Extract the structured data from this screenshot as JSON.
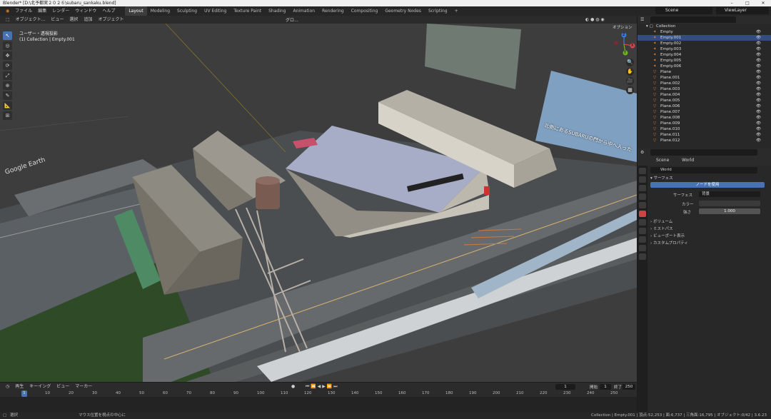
{
  "window": {
    "title": "Blender* [D:\\北予都実２０２６\\subaru_sankaku.blend]",
    "controls": [
      "–",
      "□",
      "✕"
    ]
  },
  "menus": [
    "ファイル",
    "編集",
    "レンダー",
    "ウィンドウ",
    "ヘルプ"
  ],
  "workspaces": [
    "Layout",
    "Modeling",
    "Sculpting",
    "UV Editing",
    "Texture Paint",
    "Shading",
    "Animation",
    "Rendering",
    "Compositing",
    "Geometry Nodes",
    "Scripting",
    "+"
  ],
  "active_workspace": "Layout",
  "scene_field": "Scene",
  "viewlayer_field": "ViewLayer",
  "viewport_header": {
    "mode": "オブジェクト...",
    "menus": [
      "ビュー",
      "選択",
      "追加",
      "オブジェクト"
    ],
    "transform": "グロ...",
    "options": "オプション"
  },
  "viewport_overlay": {
    "line1": "ユーザー・透視投影",
    "line2": "(1) Collection | Empty.001"
  },
  "tools": [
    "↖",
    "◎",
    "✥",
    "⟳",
    "⤢",
    "⊕",
    "✎",
    "📐",
    "⊞"
  ],
  "gizmo": {
    "x": "X",
    "y": "Y",
    "z": "Z"
  },
  "billboard_text": "北側にあるSUBARUの門から中へ入った",
  "map_label": "Google Earth",
  "outliner": {
    "root": "Collection",
    "items": [
      {
        "name": "Empty",
        "kind": "empty"
      },
      {
        "name": "Empty.001",
        "kind": "empty",
        "selected": true
      },
      {
        "name": "Empty.002",
        "kind": "empty"
      },
      {
        "name": "Empty.003",
        "kind": "empty"
      },
      {
        "name": "Empty.004",
        "kind": "empty"
      },
      {
        "name": "Empty.005",
        "kind": "empty"
      },
      {
        "name": "Empty.006",
        "kind": "empty"
      },
      {
        "name": "Plane",
        "kind": "mesh"
      },
      {
        "name": "Plane.001",
        "kind": "mesh"
      },
      {
        "name": "Plane.002",
        "kind": "mesh"
      },
      {
        "name": "Plane.003",
        "kind": "mesh"
      },
      {
        "name": "Plane.004",
        "kind": "mesh"
      },
      {
        "name": "Plane.005",
        "kind": "mesh"
      },
      {
        "name": "Plane.006",
        "kind": "mesh"
      },
      {
        "name": "Plane.007",
        "kind": "mesh"
      },
      {
        "name": "Plane.008",
        "kind": "mesh"
      },
      {
        "name": "Plane.009",
        "kind": "mesh"
      },
      {
        "name": "Plane.010",
        "kind": "mesh"
      },
      {
        "name": "Plane.011",
        "kind": "mesh"
      },
      {
        "name": "Plane.012",
        "kind": "mesh"
      }
    ]
  },
  "properties": {
    "breadcrumb_scene": "Scene",
    "breadcrumb_world": "World",
    "world_name": "World",
    "section_surface": "サーフェス",
    "use_nodes": "ノードを使用",
    "surface_label": "サーフェス",
    "surface_value": "背景",
    "color_label": "カラー",
    "strength_label": "強さ",
    "strength_value": "1.000",
    "panels": [
      "ボリューム",
      "ミストパス",
      "ビューポート表示",
      "カスタムプロパティ"
    ]
  },
  "timeline": {
    "menus": [
      "再生",
      "キーイング",
      "ビュー",
      "マーカー"
    ],
    "current": "1",
    "start_label": "開始",
    "start": "1",
    "end_label": "終了",
    "end": "250",
    "ticks": [
      "1",
      "10",
      "20",
      "30",
      "40",
      "50",
      "60",
      "70",
      "80",
      "90",
      "100",
      "110",
      "120",
      "130",
      "140",
      "150",
      "160",
      "170",
      "180",
      "190",
      "200",
      "210",
      "220",
      "230",
      "240",
      "250"
    ]
  },
  "status_bar": {
    "left": "選択",
    "center": "マウス位置を視点の中心に",
    "right": "Collection | Empty.001 | 頂点:52,253 | 面:6,737 | 三角面:16,795 | オブジェクト:0/42 | 3.6.23"
  },
  "colors": {
    "accent": "#4772b3",
    "selection": "#334d80",
    "empty_icon": "#e0823a",
    "mesh_icon": "#e07a2a",
    "warehouse_roof": "#9ea7c4",
    "building": "#8a857a",
    "grass": "#3a5a2e"
  }
}
